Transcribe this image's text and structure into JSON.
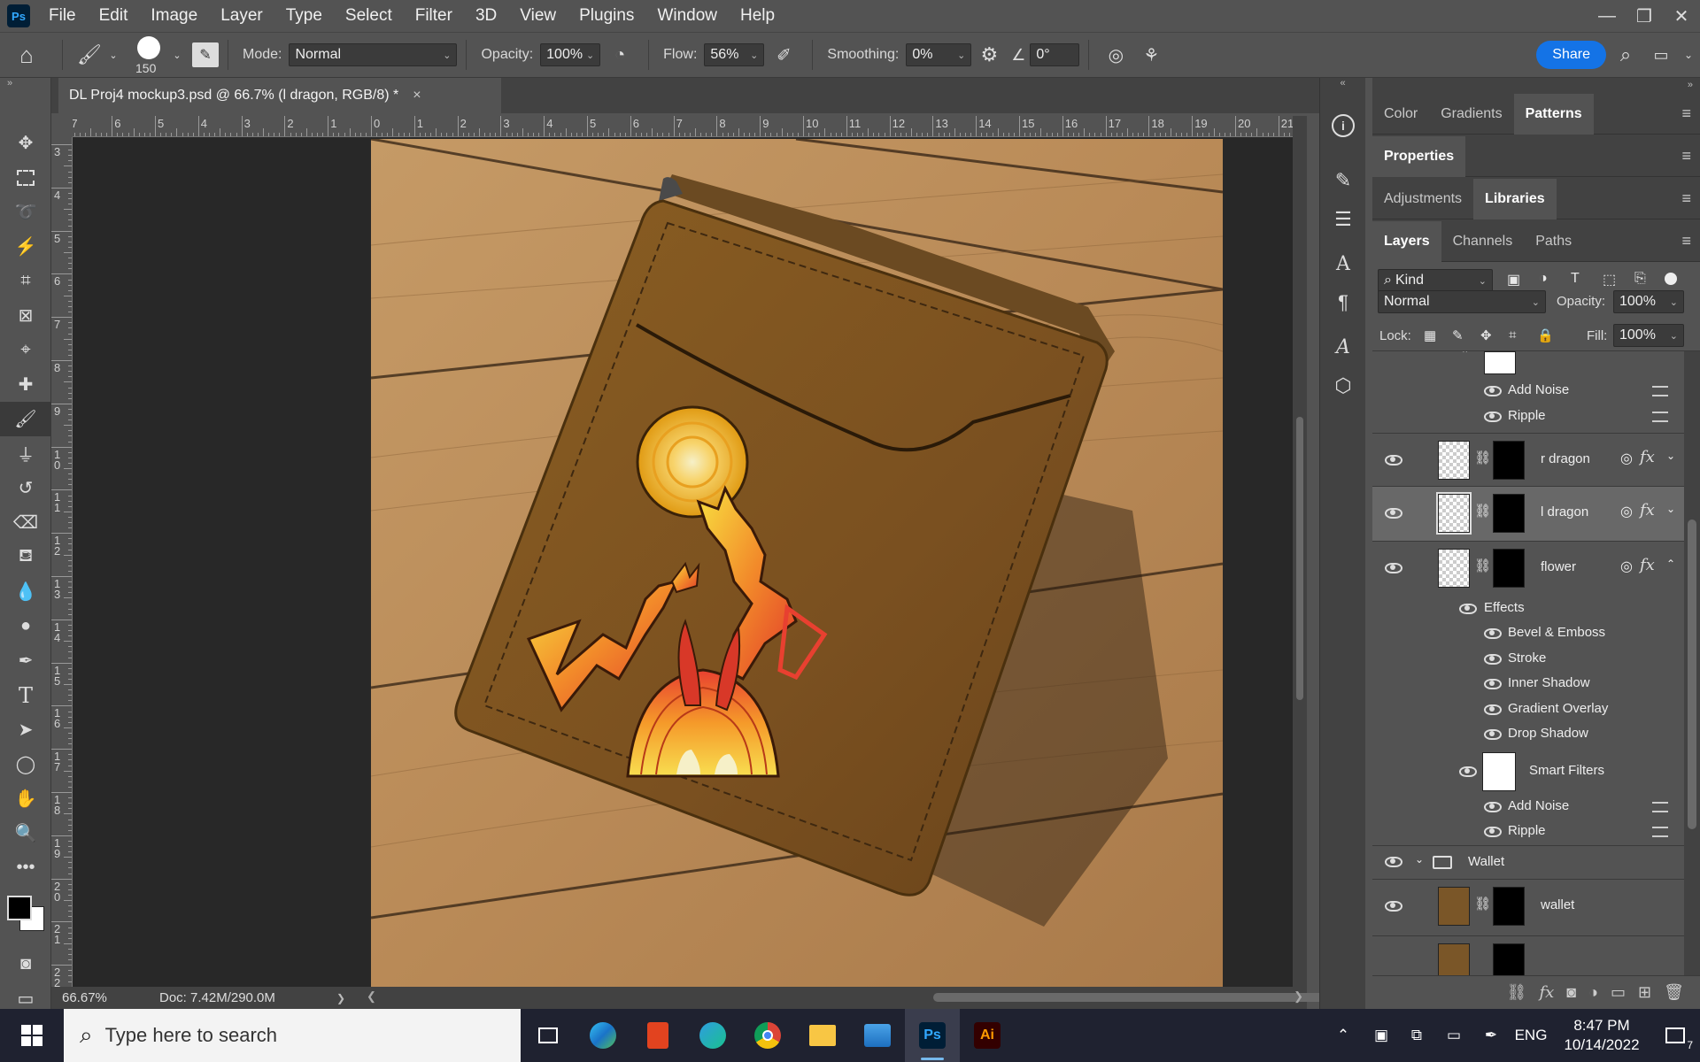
{
  "menubar": {
    "logo": "Ps",
    "items": [
      "File",
      "Edit",
      "Image",
      "Layer",
      "Type",
      "Select",
      "Filter",
      "3D",
      "View",
      "Plugins",
      "Window",
      "Help"
    ],
    "window_controls": [
      "—",
      "❐",
      "✕"
    ]
  },
  "options": {
    "brush_size": "150",
    "mode_label": "Mode:",
    "mode_value": "Normal",
    "opacity_label": "Opacity:",
    "opacity_value": "100%",
    "flow_label": "Flow:",
    "flow_value": "56%",
    "smoothing_label": "Smoothing:",
    "smoothing_value": "0%",
    "angle_value": "0°",
    "share_label": "Share"
  },
  "document": {
    "tab_title": "DL Proj4 mockup3.psd @ 66.7% (l dragon, RGB/8) *",
    "close": "×",
    "ruler_h_labels": [
      "7",
      "6",
      "5",
      "4",
      "3",
      "2",
      "1",
      "0",
      "1",
      "2",
      "3",
      "4",
      "5",
      "6",
      "7",
      "8",
      "9",
      "10",
      "11",
      "12",
      "13",
      "14",
      "15",
      "16",
      "17",
      "18",
      "19",
      "20",
      "21"
    ],
    "ruler_v_labels": [
      "3",
      "4",
      "5",
      "6",
      "7",
      "8",
      "9",
      "10",
      "11",
      "12",
      "13",
      "14",
      "15",
      "16",
      "17",
      "18",
      "19",
      "20",
      "21",
      "22"
    ]
  },
  "status": {
    "zoom": "66.67%",
    "doc": "Doc: 7.42M/290.0M",
    "arrow": "❯"
  },
  "panels": {
    "top_tabs": [
      "Color",
      "Gradients",
      "Patterns"
    ],
    "properties_tab": "Properties",
    "adj_tabs": [
      "Adjustments",
      "Libraries"
    ],
    "layer_tabs": [
      "Layers",
      "Channels",
      "Paths"
    ],
    "kind_label": "Kind",
    "blend_value": "Normal",
    "opacity_label": "Opacity:",
    "opacity_value": "100%",
    "lock_label": "Lock:",
    "fill_label": "Fill:",
    "fill_value": "100%",
    "fx": "fx"
  },
  "layers": {
    "top_filters": [
      "Add Noise",
      "Ripple"
    ],
    "r_dragon": "r dragon",
    "l_dragon": "l dragon",
    "flower": "flower",
    "effects_label": "Effects",
    "effects": [
      "Bevel & Emboss",
      "Stroke",
      "Inner Shadow",
      "Gradient Overlay",
      "Drop Shadow"
    ],
    "smart_filters": "Smart Filters",
    "bottom_filters": [
      "Add Noise",
      "Ripple"
    ],
    "group": "Wallet",
    "wallet": "wallet"
  },
  "taskbar": {
    "search_placeholder": "Type here to search",
    "lang": "ENG",
    "time": "8:47 PM",
    "date": "10/14/2022",
    "notification_count": "7"
  },
  "colors": {
    "accent": "#1473e6",
    "ui_bg": "#535353",
    "panel_bg": "#424242",
    "canvas_bg": "#282828"
  }
}
